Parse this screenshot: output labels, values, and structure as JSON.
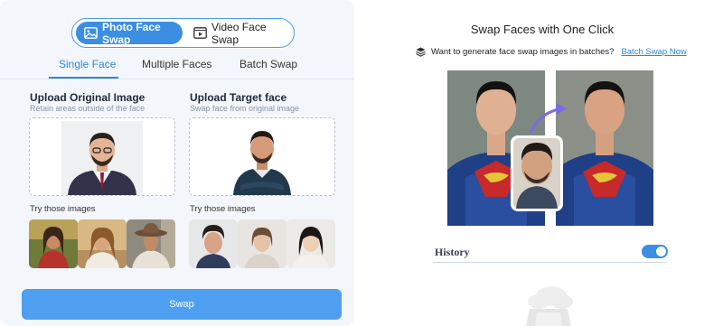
{
  "mode_toggle": {
    "photo_label": "Photo Face Swap",
    "video_label": "Video Face Swap",
    "active": "photo"
  },
  "tabs": {
    "single": "Single Face",
    "multiple": "Multiple Faces",
    "batch": "Batch Swap",
    "active": "single"
  },
  "original": {
    "title": "Upload Original Image",
    "subtitle": "Retain areas outside of the face",
    "try_label": "Try those images",
    "samples": [
      "woman-golden-hour-icon",
      "woman-sunset-field-icon",
      "man-western-hat-icon"
    ]
  },
  "target": {
    "title": "Upload Target face",
    "subtitle": "Swap face from original image",
    "try_label": "Try those images",
    "samples": [
      "man-curly-hair-icon",
      "woman-portrait-icon",
      "asian-woman-portrait-icon"
    ]
  },
  "swap_button": "Swap",
  "right": {
    "title": "Swap Faces with One Click",
    "batch_prompt": "Want to generate face swap images in batches?",
    "batch_link": "Batch Swap Now",
    "history_label": "History",
    "history_toggle_on": true
  },
  "colors": {
    "accent": "#3b8ee2",
    "link": "#2f86de",
    "panel_bg": "#f3f6fb",
    "swap_button": "#4f9ff0"
  }
}
